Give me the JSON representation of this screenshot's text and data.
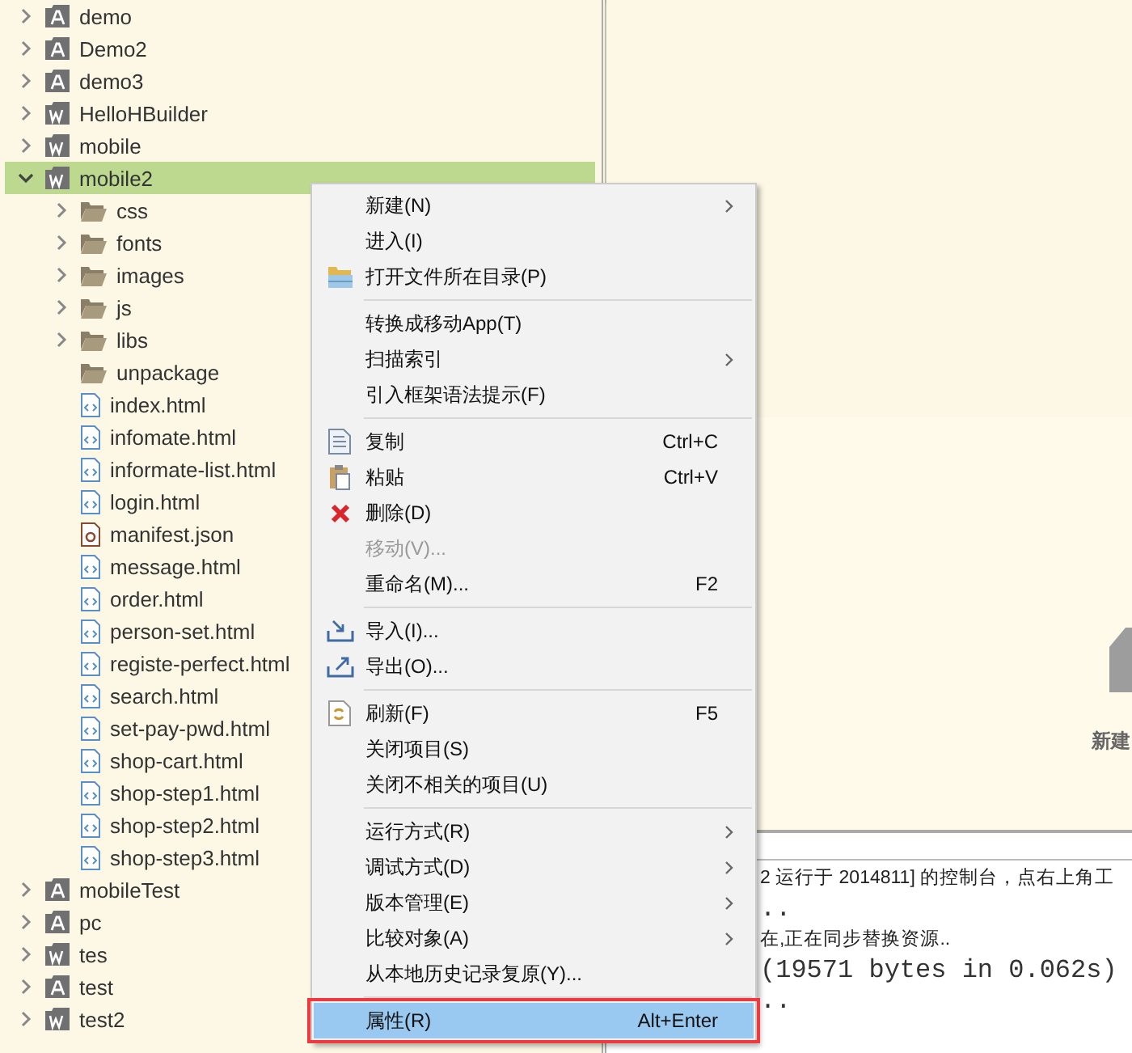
{
  "tree": [
    {
      "name": "demo",
      "kind": "project-a",
      "expanded": false,
      "selected": false
    },
    {
      "name": "Demo2",
      "kind": "project-a",
      "expanded": false,
      "selected": false
    },
    {
      "name": "demo3",
      "kind": "project-a",
      "expanded": false,
      "selected": false
    },
    {
      "name": "HelloHBuilder",
      "kind": "project-w",
      "expanded": false,
      "selected": false
    },
    {
      "name": "mobile",
      "kind": "project-w",
      "expanded": false,
      "selected": false
    },
    {
      "name": "mobile2",
      "kind": "project-w",
      "expanded": true,
      "selected": true,
      "children": [
        {
          "name": "css",
          "kind": "folder",
          "expanded": false,
          "selected": false
        },
        {
          "name": "fonts",
          "kind": "folder",
          "expanded": false,
          "selected": false
        },
        {
          "name": "images",
          "kind": "folder",
          "expanded": false,
          "selected": false
        },
        {
          "name": "js",
          "kind": "folder",
          "expanded": false,
          "selected": false
        },
        {
          "name": "libs",
          "kind": "folder",
          "expanded": false,
          "selected": false
        },
        {
          "name": "unpackage",
          "kind": "empty-folder",
          "selected": false
        },
        {
          "name": "index.html",
          "kind": "html",
          "selected": false
        },
        {
          "name": "infomate.html",
          "kind": "html",
          "selected": false
        },
        {
          "name": "informate-list.html",
          "kind": "html",
          "selected": false
        },
        {
          "name": "login.html",
          "kind": "html",
          "selected": false
        },
        {
          "name": "manifest.json",
          "kind": "json",
          "selected": false
        },
        {
          "name": "message.html",
          "kind": "html",
          "selected": false
        },
        {
          "name": "order.html",
          "kind": "html",
          "selected": false
        },
        {
          "name": "person-set.html",
          "kind": "html",
          "selected": false
        },
        {
          "name": "registe-perfect.html",
          "kind": "html",
          "selected": false
        },
        {
          "name": "search.html",
          "kind": "html",
          "selected": false
        },
        {
          "name": "set-pay-pwd.html",
          "kind": "html",
          "selected": false
        },
        {
          "name": "shop-cart.html",
          "kind": "html",
          "selected": false
        },
        {
          "name": "shop-step1.html",
          "kind": "html",
          "selected": false
        },
        {
          "name": "shop-step2.html",
          "kind": "html",
          "selected": false
        },
        {
          "name": "shop-step3.html",
          "kind": "html",
          "selected": false
        }
      ]
    },
    {
      "name": "mobileTest",
      "kind": "project-a",
      "expanded": false,
      "selected": false
    },
    {
      "name": "pc",
      "kind": "project-a",
      "expanded": false,
      "selected": false
    },
    {
      "name": "tes",
      "kind": "project-w",
      "expanded": false,
      "selected": false
    },
    {
      "name": "test",
      "kind": "project-a",
      "expanded": false,
      "selected": false
    },
    {
      "name": "test2",
      "kind": "project-w",
      "expanded": false,
      "selected": false
    }
  ],
  "welcome": {
    "label": "新建"
  },
  "console": {
    "lines": [
      {
        "text": "2 运行于 2014811] 的控制台，点右上角工",
        "kind": "info"
      },
      {
        "text": "..",
        "kind": "mono"
      },
      {
        "text": "在,正在同步替换资源..",
        "kind": "info"
      },
      {
        "text": "(19571 bytes in 0.062s)",
        "kind": "mono"
      },
      {
        "text": "..",
        "kind": "mono"
      }
    ]
  },
  "context_menu": {
    "items": [
      {
        "kind": "item",
        "label": "新建(N)",
        "submenu": true,
        "disabled": false,
        "selected": false,
        "outlined": false
      },
      {
        "kind": "item",
        "label": "进入(I)",
        "submenu": false,
        "disabled": false,
        "selected": false,
        "outlined": false
      },
      {
        "kind": "open",
        "label": "打开文件所在目录(P)",
        "submenu": false,
        "disabled": false,
        "selected": false,
        "outlined": false
      },
      {
        "kind": "separator"
      },
      {
        "kind": "item",
        "label": "转换成移动App(T)",
        "submenu": false,
        "disabled": false,
        "selected": false,
        "outlined": false
      },
      {
        "kind": "item",
        "label": "扫描索引",
        "submenu": true,
        "disabled": false,
        "selected": false,
        "outlined": false
      },
      {
        "kind": "item",
        "label": "引入框架语法提示(F)",
        "submenu": false,
        "disabled": false,
        "selected": false,
        "outlined": false
      },
      {
        "kind": "separator"
      },
      {
        "kind": "copy",
        "label": "复制",
        "shortcut": "Ctrl+C",
        "submenu": false,
        "disabled": false,
        "selected": false,
        "outlined": false
      },
      {
        "kind": "paste",
        "label": "粘贴",
        "shortcut": "Ctrl+V",
        "submenu": false,
        "disabled": false,
        "selected": false,
        "outlined": false
      },
      {
        "kind": "delete",
        "label": "删除(D)",
        "submenu": false,
        "disabled": false,
        "selected": false,
        "outlined": false
      },
      {
        "kind": "item",
        "label": "移动(V)...",
        "submenu": false,
        "disabled": true,
        "selected": false,
        "outlined": false
      },
      {
        "kind": "item",
        "label": "重命名(M)...",
        "shortcut": "F2",
        "submenu": false,
        "disabled": false,
        "selected": false,
        "outlined": false
      },
      {
        "kind": "separator"
      },
      {
        "kind": "import",
        "label": "导入(I)...",
        "submenu": false,
        "disabled": false,
        "selected": false,
        "outlined": false
      },
      {
        "kind": "export",
        "label": "导出(O)...",
        "submenu": false,
        "disabled": false,
        "selected": false,
        "outlined": false
      },
      {
        "kind": "separator"
      },
      {
        "kind": "refresh",
        "label": "刷新(F)",
        "shortcut": "F5",
        "submenu": false,
        "disabled": false,
        "selected": false,
        "outlined": false
      },
      {
        "kind": "item",
        "label": "关闭项目(S)",
        "submenu": false,
        "disabled": false,
        "selected": false,
        "outlined": false
      },
      {
        "kind": "item",
        "label": "关闭不相关的项目(U)",
        "submenu": false,
        "disabled": false,
        "selected": false,
        "outlined": false
      },
      {
        "kind": "separator"
      },
      {
        "kind": "item",
        "label": "运行方式(R)",
        "submenu": true,
        "disabled": false,
        "selected": false,
        "outlined": false
      },
      {
        "kind": "item",
        "label": "调试方式(D)",
        "submenu": true,
        "disabled": false,
        "selected": false,
        "outlined": false
      },
      {
        "kind": "item",
        "label": "版本管理(E)",
        "submenu": true,
        "disabled": false,
        "selected": false,
        "outlined": false
      },
      {
        "kind": "item",
        "label": "比较对象(A)",
        "submenu": true,
        "disabled": false,
        "selected": false,
        "outlined": false
      },
      {
        "kind": "item",
        "label": "从本地历史记录复原(Y)...",
        "submenu": false,
        "disabled": false,
        "selected": false,
        "outlined": false
      },
      {
        "kind": "separator"
      },
      {
        "kind": "item",
        "label": "属性(R)",
        "shortcut": "Alt+Enter",
        "submenu": false,
        "disabled": false,
        "selected": true,
        "outlined": true
      }
    ]
  }
}
